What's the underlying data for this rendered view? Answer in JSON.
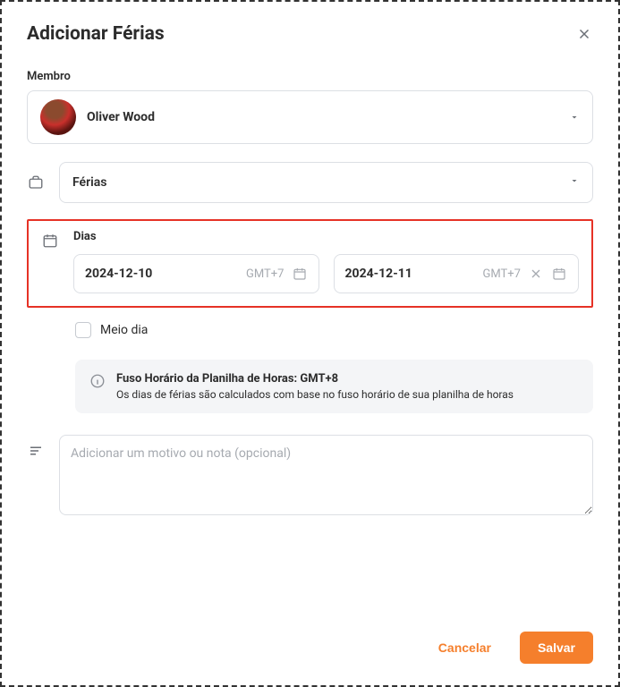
{
  "modal": {
    "title": "Adicionar Férias"
  },
  "member": {
    "label": "Membro",
    "name": "Oliver Wood"
  },
  "type": {
    "value": "Férias"
  },
  "days": {
    "label": "Dias",
    "start": {
      "value": "2024-12-10",
      "tz": "GMT+7"
    },
    "end": {
      "value": "2024-12-11",
      "tz": "GMT+7"
    },
    "halfday_label": "Meio dia"
  },
  "info": {
    "title": "Fuso Horário da Planilha de Horas: GMT+8",
    "desc": "Os dias de férias são calculados com base no fuso horário de sua planilha de horas"
  },
  "note": {
    "placeholder": "Adicionar um motivo ou nota (opcional)"
  },
  "footer": {
    "cancel": "Cancelar",
    "save": "Salvar"
  }
}
